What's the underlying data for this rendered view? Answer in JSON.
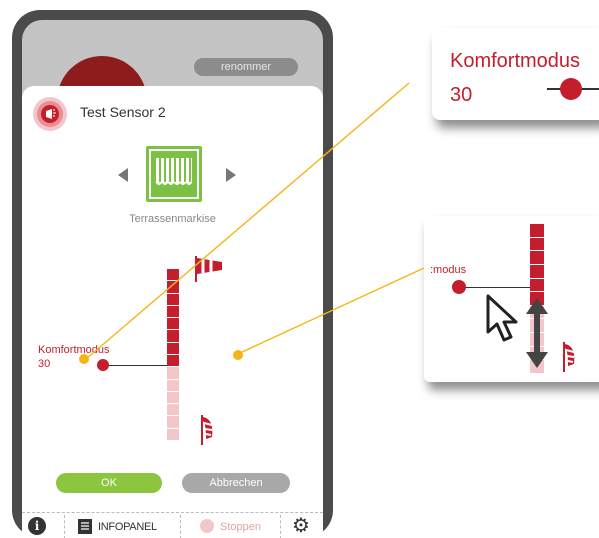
{
  "header": {
    "rename_label": "renommer"
  },
  "dialog": {
    "title": "Test Sensor 2",
    "device_type": "Terrassenmarkise",
    "comfort_mode": {
      "label": "Komfortmodus",
      "value": "30"
    },
    "scale_segments": 14,
    "scale_active_segments": 8,
    "buttons": {
      "ok": "OK",
      "cancel": "Abbrechen"
    }
  },
  "footer": {
    "info_icon": "i",
    "info_panel_label": "INFOPANEL",
    "stop_label": "Stoppen",
    "settings_icon": "gear-icon"
  },
  "zoom_callout_1": {
    "label": "Komfortmodus",
    "value": "30"
  },
  "zoom_callout_2": {
    "label": ":modus"
  },
  "colors": {
    "accent_red": "#c41e2c",
    "scale_light": "#f3c7c9",
    "ok_green": "#8cc63f",
    "callout_line": "#f6b514"
  }
}
